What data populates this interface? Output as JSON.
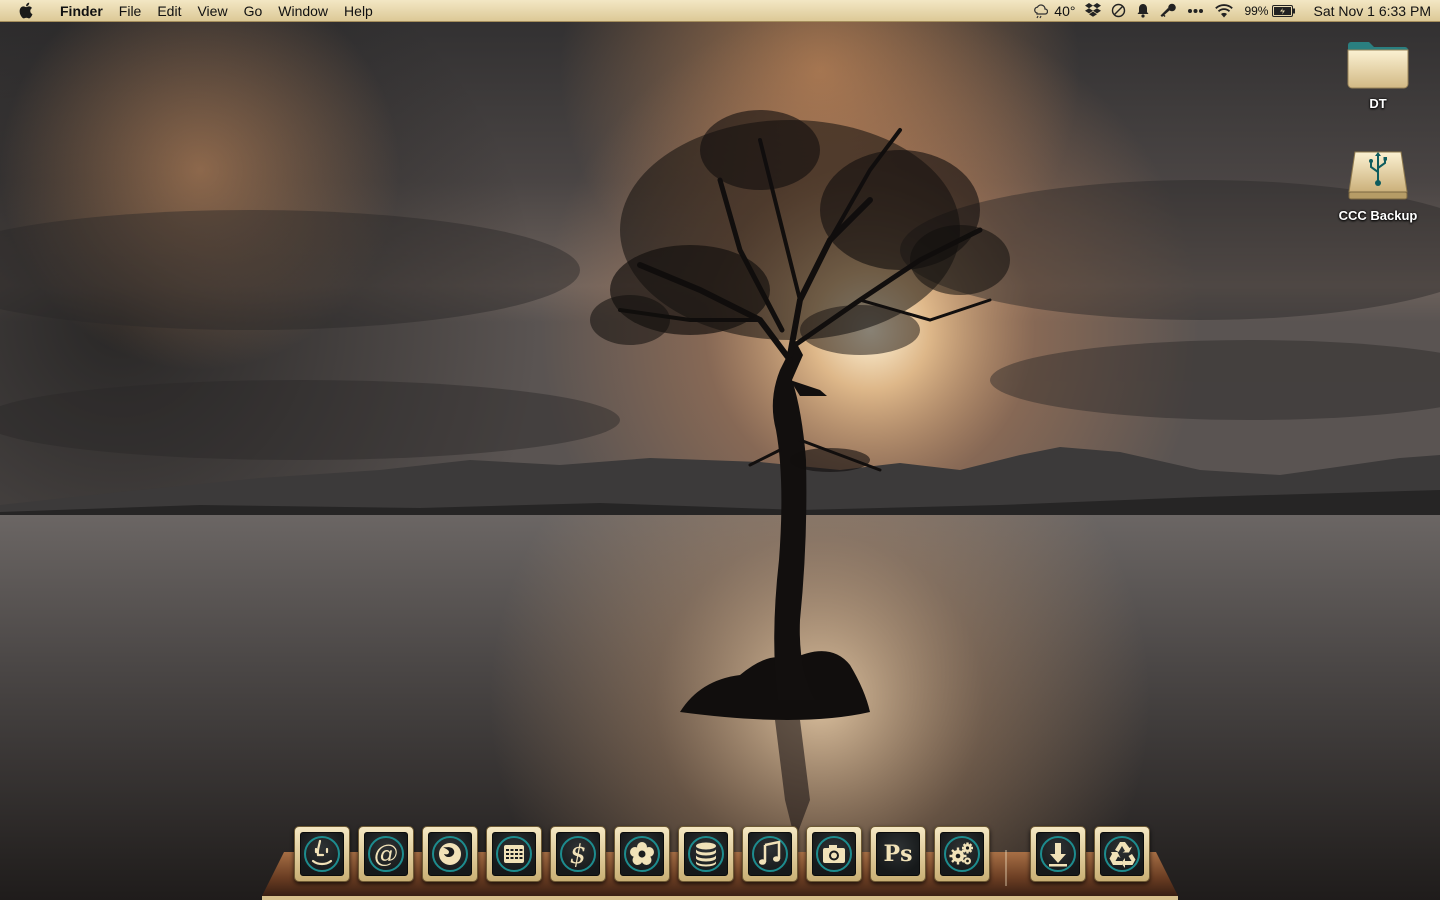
{
  "menubar": {
    "app_name": "Finder",
    "menus": [
      "File",
      "Edit",
      "View",
      "Go",
      "Window",
      "Help"
    ],
    "status": {
      "weather": "40°",
      "battery": "99%",
      "clock": "Sat Nov 1  6:33 PM"
    },
    "status_icons": [
      "weather-icon",
      "dropbox-icon",
      "sync-icon",
      "notification-bell-icon",
      "keychain-key-icon",
      "more-icon",
      "wifi-icon",
      "battery-icon"
    ]
  },
  "desktop": {
    "icons": [
      {
        "label": "DT",
        "icon": "folder-icon"
      },
      {
        "label": "CCC Backup",
        "icon": "usb-drive-icon"
      }
    ]
  },
  "dock": {
    "items": [
      {
        "name": "finder",
        "icon": "finder-icon"
      },
      {
        "name": "mail",
        "icon": "mail-at-icon"
      },
      {
        "name": "firefox",
        "icon": "firefox-icon"
      },
      {
        "name": "calendar",
        "icon": "calendar-icon"
      },
      {
        "name": "finance",
        "icon": "dollar-icon"
      },
      {
        "name": "flower",
        "icon": "flower-icon"
      },
      {
        "name": "database",
        "icon": "database-icon"
      },
      {
        "name": "music",
        "icon": "music-note-icon"
      },
      {
        "name": "camera",
        "icon": "camera-icon"
      },
      {
        "name": "photoshop",
        "icon": "photoshop-icon",
        "text": "Ps"
      },
      {
        "name": "system-preferences",
        "icon": "gears-icon"
      },
      {
        "name": "downloads",
        "icon": "download-arrow-icon"
      },
      {
        "name": "trash",
        "icon": "recycle-icon"
      }
    ]
  },
  "colors": {
    "menubar": "#e8d9ad",
    "dock_frame": "#e4cf9a",
    "dock_glyph": "#f1e2b8"
  }
}
